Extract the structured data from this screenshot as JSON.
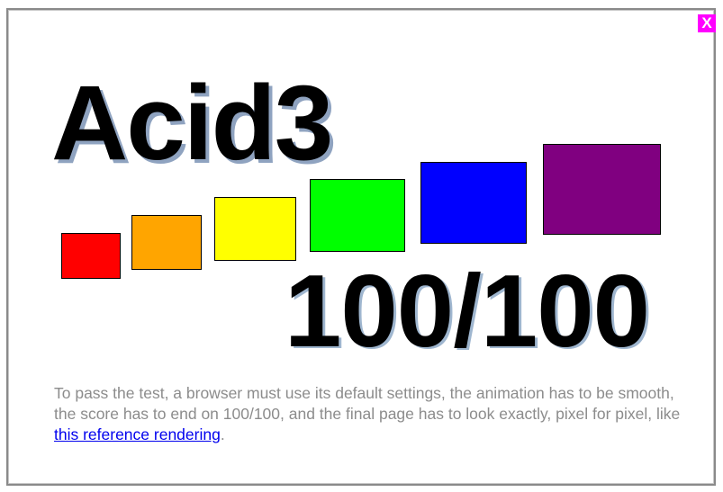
{
  "window": {
    "close_label": "X"
  },
  "title": "Acid3",
  "buckets": [
    {
      "id": "1",
      "color": "#ff0000"
    },
    {
      "id": "2",
      "color": "#ffa500"
    },
    {
      "id": "3",
      "color": "#ffff00"
    },
    {
      "id": "4",
      "color": "#00ff00"
    },
    {
      "id": "5",
      "color": "#0000ff"
    },
    {
      "id": "6",
      "color": "#800080"
    }
  ],
  "score": {
    "text": "100/100",
    "value": 100,
    "total": 100
  },
  "instructions": {
    "text_before": "To pass the test, a browser must use its default settings, the animation has to be smooth, the score has to end on 100/100, and the final page has to look exactly, pixel for pixel, like ",
    "link_text": "this reference rendering",
    "text_after": "."
  },
  "colors": {
    "close_bg": "#ff00ff",
    "instruction_text": "#8c8c8c",
    "link": "#0000ee",
    "title_shadow": "#8fa3c0"
  }
}
